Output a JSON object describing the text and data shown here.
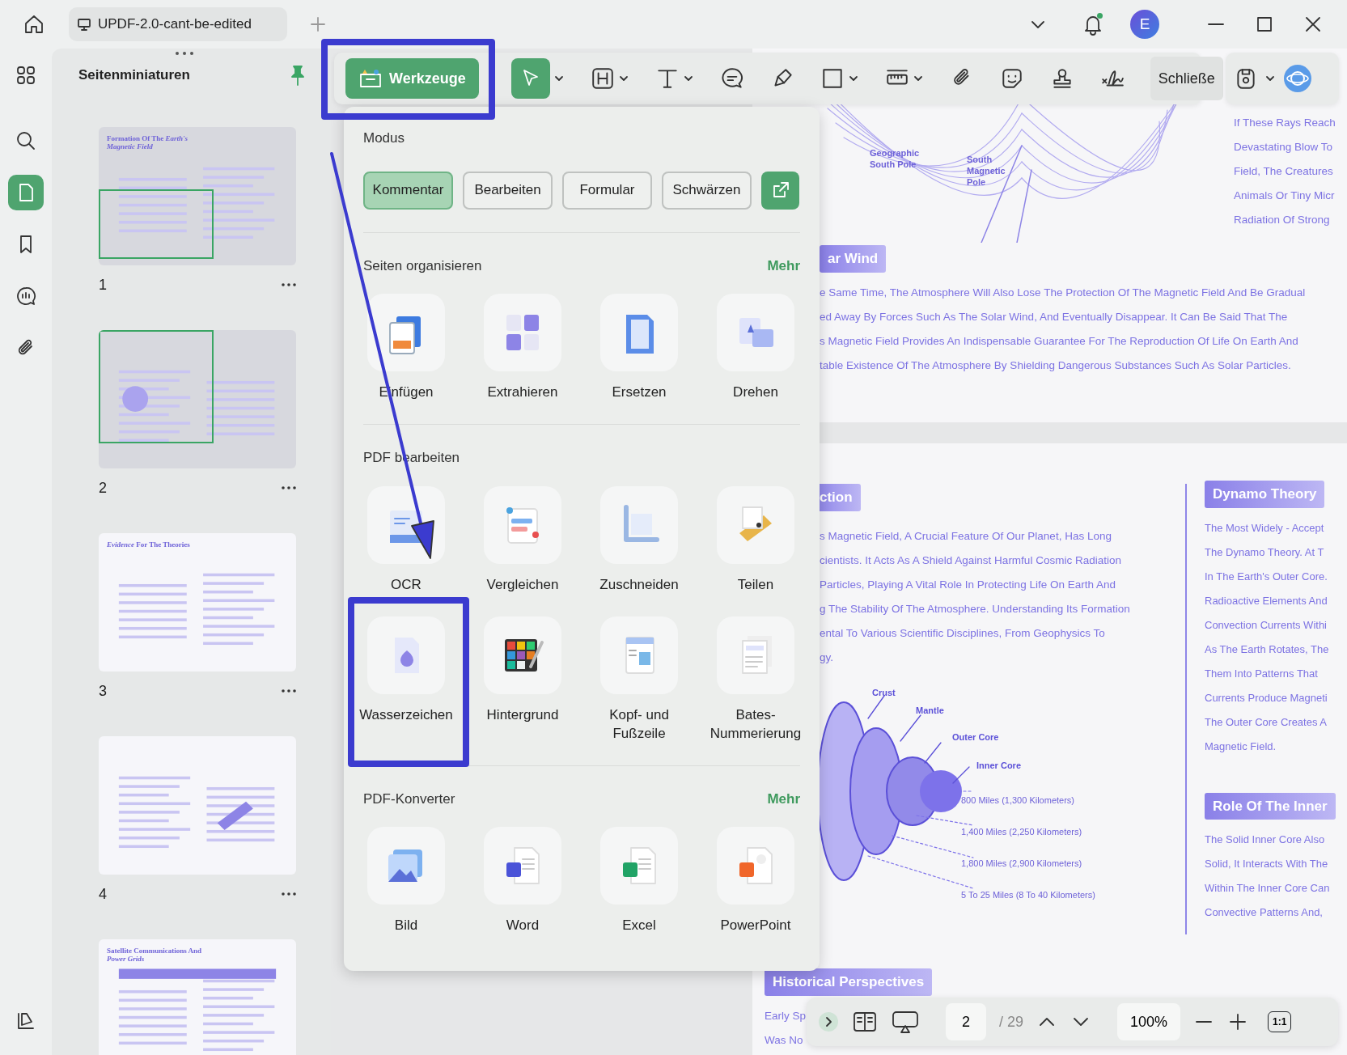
{
  "window": {
    "tab_title": "UPDF-2.0-cant-be-edited",
    "avatar_initial": "E",
    "notification_dot": true
  },
  "rail": {
    "items": [
      {
        "selected": false
      },
      {
        "selected": false
      },
      {
        "selected": true
      },
      {
        "selected": false
      },
      {
        "selected": false
      },
      {
        "selected": false
      }
    ]
  },
  "thumbnails": {
    "title": "Seitenminiaturen",
    "pages": [
      {
        "number": "1",
        "title": "Formation Of The *Earth's Magnetic Field*",
        "in_view": true
      },
      {
        "number": "2",
        "in_view": true
      },
      {
        "number": "3",
        "title": "*Evidence* For The Theories",
        "in_view": false
      },
      {
        "number": "4",
        "in_view": false
      },
      {
        "title": "Satellite Communications And *Power Grids*",
        "in_view": false
      }
    ]
  },
  "toolbar": {
    "tools_button": "Werkzeuge",
    "close_button": "Schließe"
  },
  "tools_menu": {
    "mode_title": "Modus",
    "modes": [
      {
        "label": "Kommentar",
        "selected": true
      },
      {
        "label": "Bearbeiten",
        "selected": false
      },
      {
        "label": "Formular",
        "selected": false
      },
      {
        "label": "Schwärzen",
        "selected": false
      }
    ],
    "sections": [
      {
        "title": "Seiten organisieren",
        "more": "Mehr",
        "tiles": [
          "Einfügen",
          "Extrahieren",
          "Ersetzen",
          "Drehen"
        ]
      },
      {
        "title": "PDF bearbeiten",
        "tiles": [
          "OCR",
          "Vergleichen",
          "Zuschneiden",
          "Teilen",
          "Wasserzeichen",
          "Hintergrund",
          "Kopf- und Fußzeile",
          "Bates-Nummerierung"
        ]
      },
      {
        "title": "PDF-Konverter",
        "more": "Mehr",
        "tiles": [
          "Bild",
          "Word",
          "Excel",
          "PowerPoint"
        ]
      }
    ]
  },
  "document": {
    "page_1": {
      "diagram_labels": [
        "Geographic South Pole",
        "South Magnetic Pole"
      ],
      "side_lines": [
        "If These Rays Reach",
        "Devastating Blow To",
        "Field, The Creatures",
        "Animals Or Tiny Micr",
        "Radiation Of Strong"
      ],
      "section_tag": "ar Wind",
      "paragraph_lines": [
        "e Same Time, The Atmosphere Will Also Lose The Protection Of The Magnetic Field And Be Gradual",
        "ed Away By Forces Such As The Solar Wind, And Eventually Disappear. It Can Be Said That The",
        "s Magnetic Field Provides An Indispensable Guarantee For The Reproduction Of Life On Earth And",
        "table Existence Of The Atmosphere By Shielding Dangerous Substances Such As Solar Particles."
      ]
    },
    "page_2": {
      "section_tag": "ction",
      "paragraph_lines": [
        "s Magnetic Field, A Crucial Feature Of Our Planet, Has Long",
        "cientists. It Acts As A Shield Against Harmful Cosmic Radiation",
        "Particles, Playing A Vital Role In Protecting Life On Earth And",
        "g The Stability Of The Atmosphere. Understanding Its Formation",
        "ental To Various Scientific Disciplines, From Geophysics To",
        "gy."
      ],
      "layer_labels": [
        "Crust",
        "Mantle",
        "Outer Core",
        "Inner Core"
      ],
      "distance_labels": [
        "800 Miles (1,300 Kilometers)",
        "1,400 Miles (2,250 Kilometers)",
        "1,800 Miles (2,900 Kilometers)",
        "5 To 25 Miles (8 To 40 Kilometers)"
      ],
      "side_sections": [
        {
          "tag": "Dynamo Theory",
          "lines": [
            "The Most Widely - Accept",
            "The Dynamo Theory. At T",
            "In The Earth's Outer Core.",
            "Radioactive Elements And",
            "Convection Currents Withi",
            "As The Earth Rotates, The",
            "Them Into Patterns That",
            "Currents Produce Magneti",
            "The Outer Core Creates A",
            "Magnetic Field."
          ]
        },
        {
          "tag": "Role Of The Inner",
          "lines": [
            "The Solid Inner Core Also",
            "Solid, It Interacts With The",
            "Within The Inner Core Can",
            "Convective Patterns And,"
          ]
        }
      ],
      "bottom_tag": "Historical Perspectives",
      "bottom_lines": [
        "Early Sp",
        "Was No"
      ]
    }
  },
  "bottom_bar": {
    "page_field": "2",
    "page_total": "/ 29",
    "zoom": "100%",
    "fit_label": "1:1"
  },
  "annotations": [
    {
      "kind": "frame"
    },
    {
      "kind": "arrow"
    },
    {
      "kind": "frame"
    }
  ]
}
